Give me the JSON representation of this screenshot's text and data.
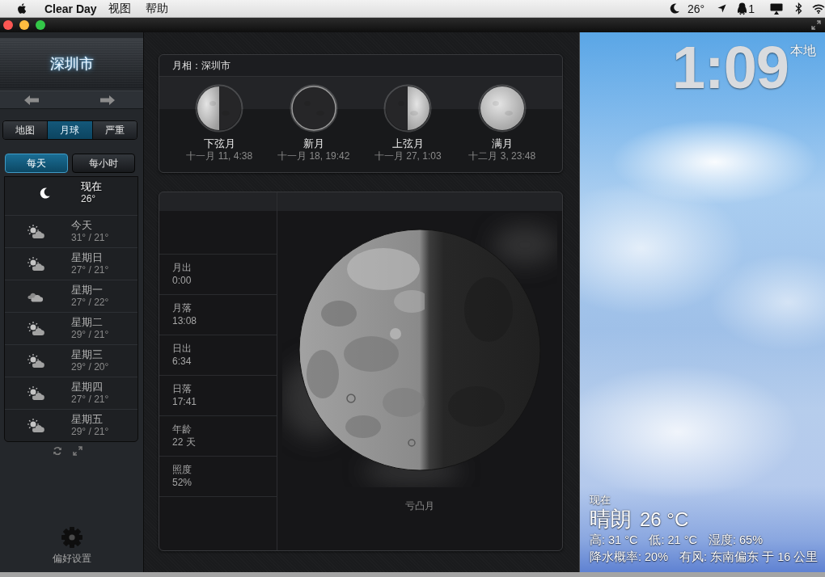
{
  "menu_bar": {
    "app_name": "Clear Day",
    "menus": [
      "视图",
      "帮助"
    ],
    "status_temperature": "26°",
    "notification_count": "1"
  },
  "sidebar": {
    "city": "深圳市",
    "view_tabs": [
      {
        "label": "地图",
        "selected": false
      },
      {
        "label": "月球",
        "selected": true
      },
      {
        "label": "严重",
        "selected": false
      }
    ],
    "range_tabs": [
      {
        "label": "每天",
        "selected": true
      },
      {
        "label": "每小时",
        "selected": false
      }
    ],
    "forecast": [
      {
        "kind": "clear-night",
        "day": "现在",
        "temps": "26°",
        "current": true
      },
      {
        "kind": "partly-cloudy",
        "day": "今天",
        "temps": "31° / 21°",
        "current": false
      },
      {
        "kind": "partly-cloudy",
        "day": "星期日",
        "temps": "27° / 21°",
        "current": false
      },
      {
        "kind": "cloudy",
        "day": "星期一",
        "temps": "27° / 22°",
        "current": false
      },
      {
        "kind": "partly-cloudy",
        "day": "星期二",
        "temps": "29° / 21°",
        "current": false
      },
      {
        "kind": "partly-cloudy",
        "day": "星期三",
        "temps": "29° / 20°",
        "current": false
      },
      {
        "kind": "partly-cloudy",
        "day": "星期四",
        "temps": "27° / 21°",
        "current": false
      },
      {
        "kind": "partly-cloudy",
        "day": "星期五",
        "temps": "29° / 21°",
        "current": false
      }
    ],
    "preferences_label": "偏好设置"
  },
  "moon_phases": {
    "title": "月相：深圳市",
    "phases": [
      {
        "kind": "last-quarter",
        "name": "下弦月",
        "date": "十一月 11, 4:38"
      },
      {
        "kind": "new",
        "name": "新月",
        "date": "十一月 18, 19:42"
      },
      {
        "kind": "first-quarter",
        "name": "上弦月",
        "date": "十一月 27, 1:03"
      },
      {
        "kind": "full",
        "name": "满月",
        "date": "十二月 3, 23:48"
      }
    ]
  },
  "moon_details": {
    "rows": [
      {
        "label": "月出",
        "value": "0:00"
      },
      {
        "label": "月落",
        "value": "13:08"
      },
      {
        "label": "日出",
        "value": "6:34"
      },
      {
        "label": "日落",
        "value": "17:41"
      },
      {
        "label": "年龄",
        "value": "22 天"
      },
      {
        "label": "照度",
        "value": "52%"
      }
    ],
    "phase_name": "亏凸月"
  },
  "current_weather": {
    "time": "1:09",
    "time_zone": "本地",
    "now_label": "现在",
    "condition": "晴朗",
    "temperature": "26 °C",
    "stats_line_1": [
      "高: 31 °C",
      "低: 21 °C",
      "湿度: 65%"
    ],
    "stats_line_2": [
      "降水概率: 20%",
      "有风: 东南偏东 于 16 公里"
    ]
  }
}
